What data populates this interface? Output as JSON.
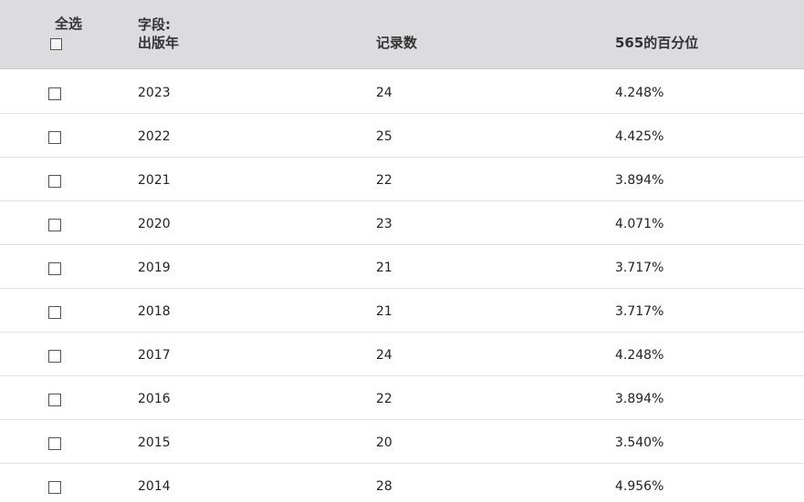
{
  "header": {
    "select_all_label": "全选",
    "field_prefix": "字段:",
    "field_name": "出版年",
    "count_label": "记录数",
    "percent_label": "565的百分位"
  },
  "rows": [
    {
      "year": "2023",
      "count": "24",
      "percent": "4.248%"
    },
    {
      "year": "2022",
      "count": "25",
      "percent": "4.425%"
    },
    {
      "year": "2021",
      "count": "22",
      "percent": "3.894%"
    },
    {
      "year": "2020",
      "count": "23",
      "percent": "4.071%"
    },
    {
      "year": "2019",
      "count": "21",
      "percent": "3.717%"
    },
    {
      "year": "2018",
      "count": "21",
      "percent": "3.717%"
    },
    {
      "year": "2017",
      "count": "24",
      "percent": "4.248%"
    },
    {
      "year": "2016",
      "count": "22",
      "percent": "3.894%"
    },
    {
      "year": "2015",
      "count": "20",
      "percent": "3.540%"
    },
    {
      "year": "2014",
      "count": "28",
      "percent": "4.956%"
    }
  ]
}
